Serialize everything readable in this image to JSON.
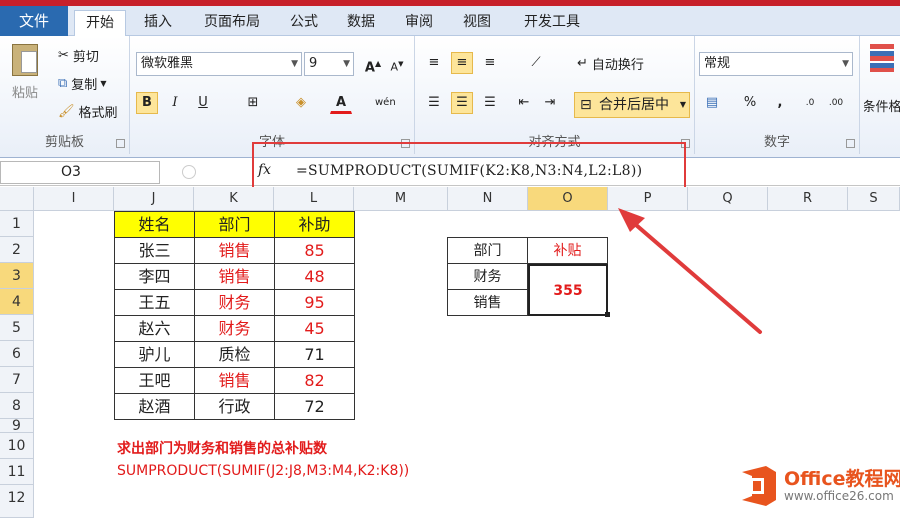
{
  "ribbon_tabs": [
    "文件",
    "开始",
    "插入",
    "页面布局",
    "公式",
    "数据",
    "审阅",
    "视图",
    "开发工具"
  ],
  "clipboard": {
    "paste": "粘贴",
    "cut": "剪切",
    "copy": "复制",
    "format_painter": "格式刷",
    "label": "剪贴板"
  },
  "font": {
    "name": "微软雅黑",
    "size": "9",
    "bold": "B",
    "italic": "I",
    "underline": "U",
    "label": "字体"
  },
  "alignment": {
    "wrap": "自动换行",
    "merge": "合并后居中",
    "label": "对齐方式"
  },
  "number": {
    "format": "常规",
    "label": "数字",
    "percent": "%",
    "comma": ",",
    "cond": "条件格"
  },
  "formula_bar": {
    "name_box": "O3",
    "fx": "fx",
    "formula": "=SUMPRODUCT(SUMIF(K2:K8,N3:N4,L2:L8))"
  },
  "columns": [
    "I",
    "J",
    "K",
    "L",
    "M",
    "N",
    "O",
    "P",
    "Q",
    "R",
    "S"
  ],
  "selected_column": "O",
  "rows": [
    "1",
    "2",
    "3",
    "4",
    "5",
    "6",
    "7",
    "8",
    "9",
    "10",
    "11",
    "12"
  ],
  "selected_rows": [
    "3",
    "4"
  ],
  "table": {
    "headers": [
      "姓名",
      "部门",
      "补助"
    ],
    "rows": [
      [
        "张三",
        "销售",
        "85"
      ],
      [
        "李四",
        "销售",
        "48"
      ],
      [
        "王五",
        "财务",
        "95"
      ],
      [
        "赵六",
        "财务",
        "45"
      ],
      [
        "驴儿",
        "质检",
        "71"
      ],
      [
        "王吧",
        "销售",
        "82"
      ],
      [
        "赵酒",
        "行政",
        "72"
      ]
    ],
    "highlight_color": "#e21b1b",
    "header_fill": "#ffff00"
  },
  "criteria": {
    "header_dept": "部门",
    "header_sub": "补贴",
    "dept1": "财务",
    "dept2": "销售",
    "result": "355"
  },
  "notes": {
    "line1": "求出部门为财务和销售的总补贴数",
    "line2": "SUMPRODUCT(SUMIF(J2:J8,M3:M4,K2:K8))"
  },
  "watermark": {
    "brand": "Office教程网",
    "url": "www.office26.com"
  }
}
